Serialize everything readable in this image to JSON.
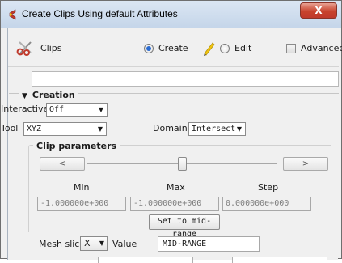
{
  "window": {
    "title": "Create Clips Using default Attributes",
    "close_label": "X"
  },
  "toolbar": {
    "clips_label": "Clips",
    "create_label": "Create",
    "edit_label": "Edit",
    "advanced_label": "Advanced",
    "mode_selected": "Create",
    "advanced_checked": false
  },
  "name_field": {
    "value": ""
  },
  "creation": {
    "title": "Creation",
    "interactive_label": "Interactive",
    "interactive_value": "Off",
    "tool_label": "Tool",
    "tool_value": "XYZ",
    "domain_label": "Domain",
    "domain_value": "Intersect"
  },
  "clip_parameters": {
    "title": "Clip parameters",
    "prev_label": "<",
    "next_label": ">",
    "slider_position": 0.5,
    "min_label": "Min",
    "max_label": "Max",
    "step_label": "Step",
    "min_value": "-1.000000e+000",
    "max_value": "-1.000000e+000",
    "step_value": "0.000000e+000",
    "mid_button": "Set to mid-range"
  },
  "mesh_slice": {
    "label": "Mesh slice",
    "axis_value": "X",
    "value_label": "Value",
    "value": "MID-RANGE"
  },
  "colors": {
    "accent": "#2a6bd1",
    "title_bar": "#c4d5e9",
    "close_button": "#c8432d",
    "background": "#f0f0f0"
  },
  "icons": {
    "app": "app-icon",
    "clips": "scissors-icon",
    "edit": "pencil-icon",
    "dropdown": "chevron-down-icon"
  }
}
